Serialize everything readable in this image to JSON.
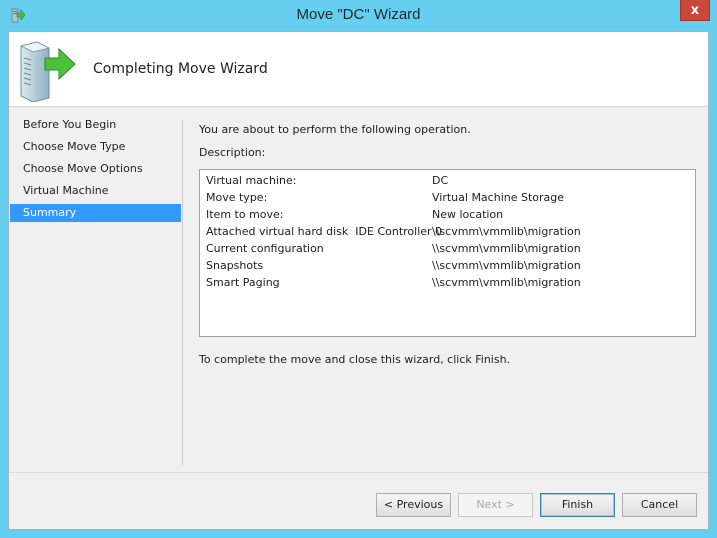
{
  "window": {
    "title": "Move \"DC\" Wizard",
    "close_label": "x"
  },
  "header": {
    "title": "Completing Move Wizard"
  },
  "nav": {
    "items": [
      {
        "label": "Before You Begin",
        "selected": false
      },
      {
        "label": "Choose Move Type",
        "selected": false
      },
      {
        "label": "Choose Move Options",
        "selected": false
      },
      {
        "label": "Virtual Machine",
        "selected": false
      },
      {
        "label": "Summary",
        "selected": true
      }
    ]
  },
  "content": {
    "intro": "You are about to perform the following operation.",
    "description_label": "Description:",
    "rows": [
      {
        "key": "Virtual machine:",
        "value": "DC"
      },
      {
        "key": "Move type:",
        "value": "Virtual Machine Storage"
      },
      {
        "key": "Item to move:",
        "value": "New location"
      },
      {
        "key": "Attached virtual hard disk  IDE Controller 0",
        "value": "\\\\scvmm\\vmmlib\\migration"
      },
      {
        "key": "Current configuration",
        "value": "\\\\scvmm\\vmmlib\\migration"
      },
      {
        "key": "Snapshots",
        "value": "\\\\scvmm\\vmmlib\\migration"
      },
      {
        "key": "Smart Paging",
        "value": "\\\\scvmm\\vmmlib\\migration"
      }
    ],
    "finish_note": "To complete the move and close this wizard, click Finish."
  },
  "buttons": {
    "previous": "< Previous",
    "next": "Next >",
    "finish": "Finish",
    "cancel": "Cancel"
  },
  "colors": {
    "titlebar": "#66cfef",
    "selection": "#3399ff",
    "close": "#c8483b"
  }
}
